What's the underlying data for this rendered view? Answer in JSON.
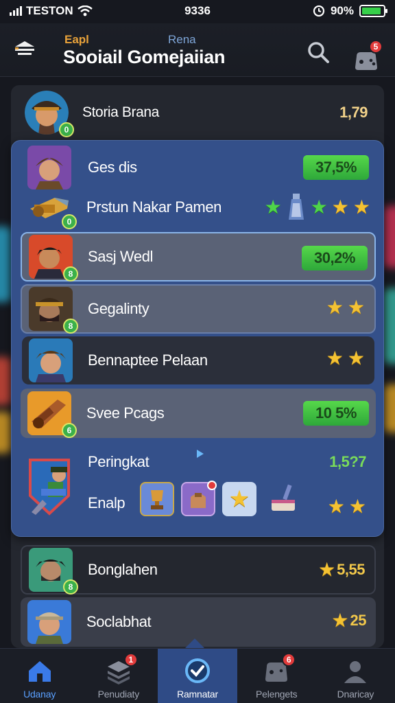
{
  "status_bar": {
    "carrier": "TESTON",
    "time": "9336",
    "battery_percent": "90%",
    "battery_level": 0.9
  },
  "header": {
    "subtitle_left": "Eapl",
    "subtitle_right": "Rena",
    "title": "Sooiail Gomejaiian",
    "notification_count": "5"
  },
  "leaderboard": [
    {
      "name": "Storia Brana",
      "score": "1,79",
      "level": "0",
      "style": "top"
    },
    {
      "name": "Ges dis",
      "score": "37,5%",
      "style": "plain"
    },
    {
      "name": "Prstun Nakar Pamen",
      "level": "0",
      "style": "plain"
    },
    {
      "name": "Sasj Wedl",
      "score": "30,2%",
      "level": "8",
      "style": "highlight"
    },
    {
      "name": "Gegalinty",
      "level": "8",
      "style": "card"
    },
    {
      "name": "Bennaptee Pelaan",
      "style": "dark"
    },
    {
      "name": "Svee Pcags",
      "score": "10 5%",
      "level": "6",
      "style": "card"
    },
    {
      "name": "Peringkat",
      "score": "1,5?7",
      "style": "plain"
    },
    {
      "name": "Enalp",
      "style": "plain"
    },
    {
      "name": "Bonglahen",
      "score": "5,55",
      "level": "8",
      "style": "dark"
    },
    {
      "name": "Soclabhat",
      "score": "25",
      "style": "card"
    }
  ],
  "colors": {
    "accent": "#34508a",
    "score_green": "#46c842",
    "star": "#f4c232",
    "badge": "#e23b3b"
  },
  "nav": [
    {
      "label": "Udanay",
      "icon": "home-icon",
      "active": false
    },
    {
      "label": "Penudiaty",
      "icon": "stack-icon",
      "active": false,
      "badge": "1"
    },
    {
      "label": "Ramnatar",
      "icon": "clock-icon",
      "active": true
    },
    {
      "label": "Pelengets",
      "icon": "gamepad-icon",
      "active": false,
      "badge": "6"
    },
    {
      "label": "Dnaricay",
      "icon": "profile-icon",
      "active": false
    }
  ]
}
